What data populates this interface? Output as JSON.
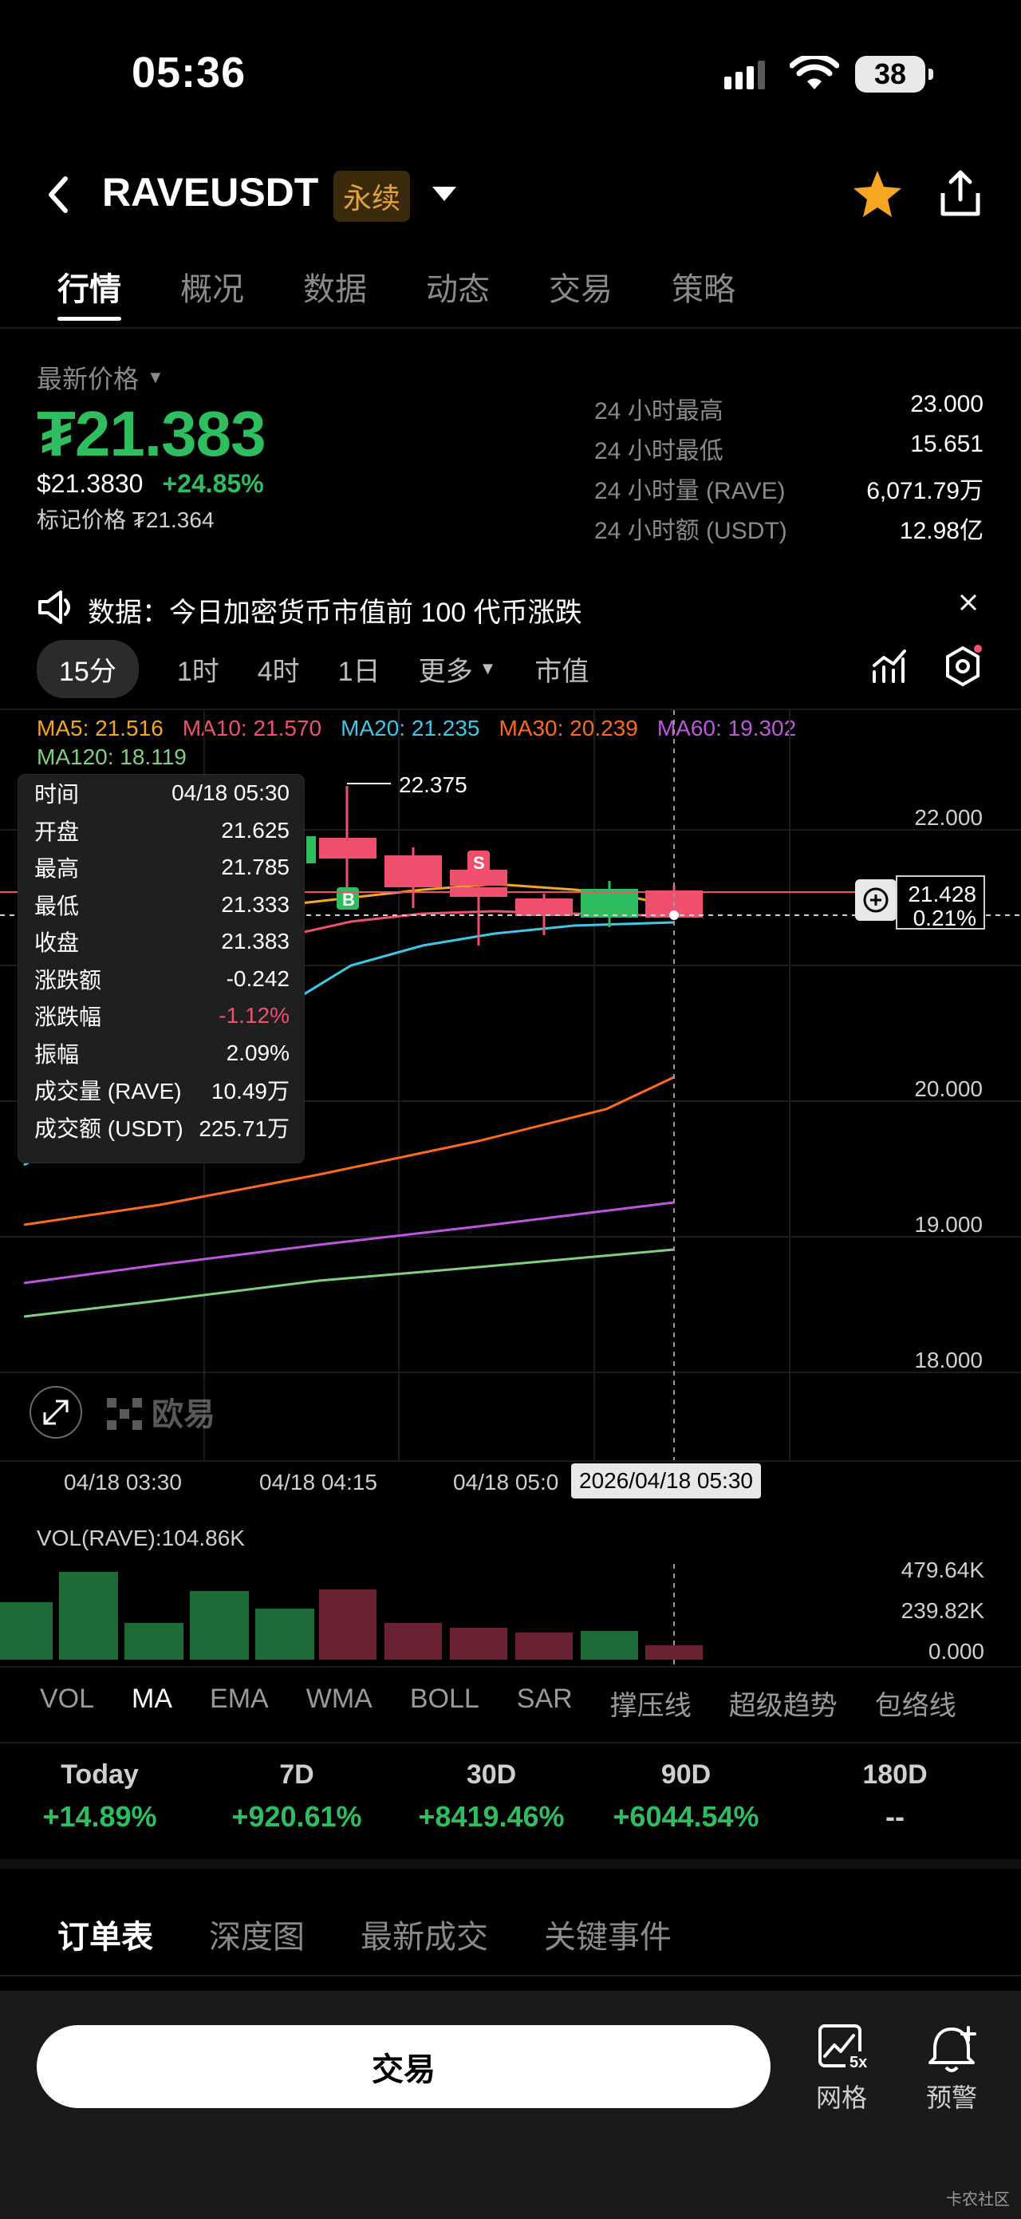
{
  "status": {
    "time": "05:36",
    "battery": "38"
  },
  "header": {
    "symbol": "RAVEUSDT",
    "badge": "永续"
  },
  "tabs": [
    "行情",
    "概况",
    "数据",
    "动态",
    "交易",
    "策略"
  ],
  "price": {
    "label": "最新价格",
    "last": "₮21.383",
    "usd": "$21.3830",
    "change": "+24.85%",
    "mark": "标记价格 ₮21.364"
  },
  "stats": [
    {
      "k": "24 小时最高",
      "v": "23.000"
    },
    {
      "k": "24 小时最低",
      "v": "15.651"
    },
    {
      "k": "24 小时量 (RAVE)",
      "v": "6,071.79万"
    },
    {
      "k": "24 小时额 (USDT)",
      "v": "12.98亿"
    }
  ],
  "notice": "数据：今日加密货币市值前 100 代币涨跌",
  "timeframes": [
    "15分",
    "1时",
    "4时",
    "1日",
    "更多",
    "市值"
  ],
  "ma": {
    "ma5": "MA5: 21.516",
    "ma10": "MA10: 21.570",
    "ma20": "MA20: 21.235",
    "ma30": "MA30: 20.239",
    "ma60": "MA60: 19.302",
    "ma120": "MA120: 18.119"
  },
  "colors": {
    "ma5": "#f5a623",
    "ma10": "#f0506e",
    "ma20": "#3cc8e8",
    "ma30": "#ff6a1a",
    "ma60": "#c155e0",
    "ma120": "#7ed07e",
    "up": "#2ebd5f",
    "down": "#f0506e"
  },
  "tooltip": [
    {
      "k": "时间",
      "v": "04/18 05:30"
    },
    {
      "k": "开盘",
      "v": "21.625"
    },
    {
      "k": "最高",
      "v": "21.785"
    },
    {
      "k": "最低",
      "v": "21.333"
    },
    {
      "k": "收盘",
      "v": "21.383"
    },
    {
      "k": "涨跌额",
      "v": "-0.242"
    },
    {
      "k": "涨跌幅",
      "v": "-1.12%"
    },
    {
      "k": "振幅",
      "v": "2.09%"
    },
    {
      "k": "成交量 (RAVE)",
      "v": "10.49万"
    },
    {
      "k": "成交额 (USDT)",
      "v": "225.71万"
    }
  ],
  "chart": {
    "high_label": "22.375",
    "y_ticks": [
      "22.000",
      "20.000",
      "19.000",
      "18.000"
    ],
    "cross_price": "21.428",
    "cross_pct": "0.21%",
    "x_ticks": [
      "04/18 03:30",
      "04/18 04:15",
      "04/18 05:0"
    ],
    "cross_time": "2026/04/18 05:30",
    "watermark": "欧易"
  },
  "volume": {
    "label": "VOL(RAVE):104.86K",
    "ticks": [
      "479.64K",
      "239.82K",
      "0.000"
    ]
  },
  "indicators": [
    "VOL",
    "MA",
    "EMA",
    "WMA",
    "BOLL",
    "SAR",
    "撑压线",
    "超级趋势",
    "包络线"
  ],
  "performance": [
    {
      "label": "Today",
      "value": "+14.89%"
    },
    {
      "label": "7D",
      "value": "+920.61%"
    },
    {
      "label": "30D",
      "value": "+8419.46%"
    },
    {
      "label": "90D",
      "value": "+6044.54%"
    },
    {
      "label": "180D",
      "value": "--"
    }
  ],
  "orderbook_tabs": [
    "订单表",
    "深度图",
    "最新成交",
    "关键事件"
  ],
  "bottom": {
    "trade": "交易",
    "grid": "网格",
    "alert": "预警",
    "grid_badge": "5x",
    "community": "卡农社区"
  }
}
